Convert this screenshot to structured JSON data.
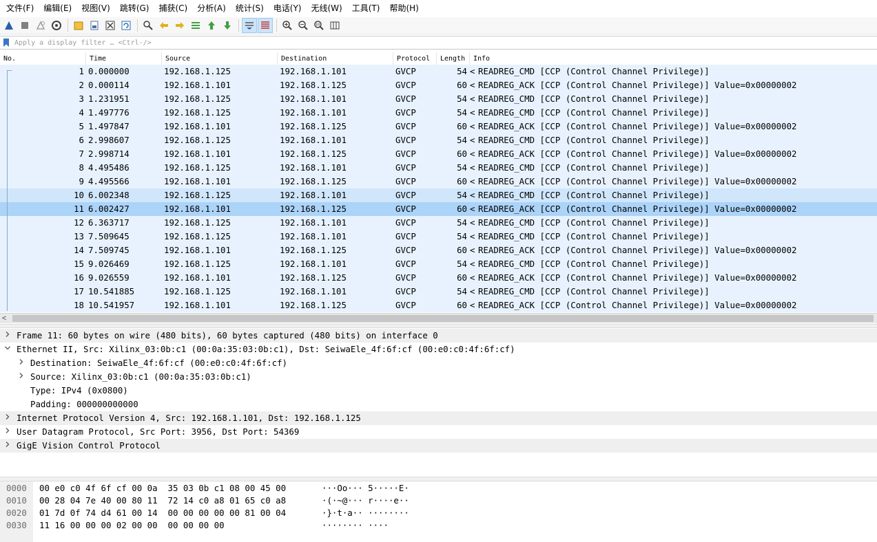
{
  "menu": [
    "文件(F)",
    "编辑(E)",
    "视图(V)",
    "跳转(G)",
    "捕获(C)",
    "分析(A)",
    "统计(S)",
    "电话(Y)",
    "无线(W)",
    "工具(T)",
    "帮助(H)"
  ],
  "filter": {
    "placeholder": "Apply a display filter … <Ctrl-/>"
  },
  "columns": {
    "no": "No.",
    "time": "Time",
    "source": "Source",
    "destination": "Destination",
    "protocol": "Protocol",
    "length": "Length",
    "info": "Info"
  },
  "packets": [
    {
      "no": "1",
      "time": "0.000000",
      "src": "192.168.1.125",
      "dst": "192.168.1.101",
      "proto": "GVCP",
      "len": "54",
      "info": "READREG_CMD [CCP (Control Channel Privilege)]"
    },
    {
      "no": "2",
      "time": "0.000114",
      "src": "192.168.1.101",
      "dst": "192.168.1.125",
      "proto": "GVCP",
      "len": "60",
      "info": "READREG_ACK [CCP (Control Channel Privilege)] Value=0x00000002"
    },
    {
      "no": "3",
      "time": "1.231951",
      "src": "192.168.1.125",
      "dst": "192.168.1.101",
      "proto": "GVCP",
      "len": "54",
      "info": "READREG_CMD [CCP (Control Channel Privilege)]"
    },
    {
      "no": "4",
      "time": "1.497776",
      "src": "192.168.1.125",
      "dst": "192.168.1.101",
      "proto": "GVCP",
      "len": "54",
      "info": "READREG_CMD [CCP (Control Channel Privilege)]"
    },
    {
      "no": "5",
      "time": "1.497847",
      "src": "192.168.1.101",
      "dst": "192.168.1.125",
      "proto": "GVCP",
      "len": "60",
      "info": "READREG_ACK [CCP (Control Channel Privilege)] Value=0x00000002"
    },
    {
      "no": "6",
      "time": "2.998607",
      "src": "192.168.1.125",
      "dst": "192.168.1.101",
      "proto": "GVCP",
      "len": "54",
      "info": "READREG_CMD [CCP (Control Channel Privilege)]"
    },
    {
      "no": "7",
      "time": "2.998714",
      "src": "192.168.1.101",
      "dst": "192.168.1.125",
      "proto": "GVCP",
      "len": "60",
      "info": "READREG_ACK [CCP (Control Channel Privilege)] Value=0x00000002"
    },
    {
      "no": "8",
      "time": "4.495486",
      "src": "192.168.1.125",
      "dst": "192.168.1.101",
      "proto": "GVCP",
      "len": "54",
      "info": "READREG_CMD [CCP (Control Channel Privilege)]"
    },
    {
      "no": "9",
      "time": "4.495566",
      "src": "192.168.1.101",
      "dst": "192.168.1.125",
      "proto": "GVCP",
      "len": "60",
      "info": "READREG_ACK [CCP (Control Channel Privilege)] Value=0x00000002"
    },
    {
      "no": "10",
      "time": "6.002348",
      "src": "192.168.1.125",
      "dst": "192.168.1.101",
      "proto": "GVCP",
      "len": "54",
      "info": "READREG_CMD [CCP (Control Channel Privilege)]"
    },
    {
      "no": "11",
      "time": "6.002427",
      "src": "192.168.1.101",
      "dst": "192.168.1.125",
      "proto": "GVCP",
      "len": "60",
      "info": "READREG_ACK [CCP (Control Channel Privilege)] Value=0x00000002"
    },
    {
      "no": "12",
      "time": "6.363717",
      "src": "192.168.1.125",
      "dst": "192.168.1.101",
      "proto": "GVCP",
      "len": "54",
      "info": "READREG_CMD [CCP (Control Channel Privilege)]"
    },
    {
      "no": "13",
      "time": "7.509645",
      "src": "192.168.1.125",
      "dst": "192.168.1.101",
      "proto": "GVCP",
      "len": "54",
      "info": "READREG_CMD [CCP (Control Channel Privilege)]"
    },
    {
      "no": "14",
      "time": "7.509745",
      "src": "192.168.1.101",
      "dst": "192.168.1.125",
      "proto": "GVCP",
      "len": "60",
      "info": "READREG_ACK [CCP (Control Channel Privilege)] Value=0x00000002"
    },
    {
      "no": "15",
      "time": "9.026469",
      "src": "192.168.1.125",
      "dst": "192.168.1.101",
      "proto": "GVCP",
      "len": "54",
      "info": "READREG_CMD [CCP (Control Channel Privilege)]"
    },
    {
      "no": "16",
      "time": "9.026559",
      "src": "192.168.1.101",
      "dst": "192.168.1.125",
      "proto": "GVCP",
      "len": "60",
      "info": "READREG_ACK [CCP (Control Channel Privilege)] Value=0x00000002"
    },
    {
      "no": "17",
      "time": "10.541885",
      "src": "192.168.1.125",
      "dst": "192.168.1.101",
      "proto": "GVCP",
      "len": "54",
      "info": "READREG_CMD [CCP (Control Channel Privilege)]"
    },
    {
      "no": "18",
      "time": "10.541957",
      "src": "192.168.1.101",
      "dst": "192.168.1.125",
      "proto": "GVCP",
      "len": "60",
      "info": "READREG_ACK [CCP (Control Channel Privilege)] Value=0x00000002"
    }
  ],
  "selected_packet": "11",
  "related_packet": "10",
  "details": [
    {
      "text": "Frame 11: 60 bytes on wire (480 bits), 60 bytes captured (480 bits) on interface 0",
      "level": 0,
      "expander": "collapsed",
      "shaded": true
    },
    {
      "text": "Ethernet II, Src: Xilinx_03:0b:c1 (00:0a:35:03:0b:c1), Dst: SeiwaEle_4f:6f:cf (00:e0:c0:4f:6f:cf)",
      "level": 0,
      "expander": "expanded",
      "shaded": false
    },
    {
      "text": "Destination: SeiwaEle_4f:6f:cf (00:e0:c0:4f:6f:cf)",
      "level": 1,
      "expander": "collapsed",
      "shaded": false
    },
    {
      "text": "Source: Xilinx_03:0b:c1 (00:0a:35:03:0b:c1)",
      "level": 1,
      "expander": "collapsed",
      "shaded": false
    },
    {
      "text": "Type: IPv4 (0x0800)",
      "level": 1,
      "expander": "none",
      "shaded": false
    },
    {
      "text": "Padding: 000000000000",
      "level": 1,
      "expander": "none",
      "shaded": false
    },
    {
      "text": "Internet Protocol Version 4, Src: 192.168.1.101, Dst: 192.168.1.125",
      "level": 0,
      "expander": "collapsed",
      "shaded": true
    },
    {
      "text": "User Datagram Protocol, Src Port: 3956, Dst Port: 54369",
      "level": 0,
      "expander": "collapsed",
      "shaded": false
    },
    {
      "text": "GigE Vision Control Protocol",
      "level": 0,
      "expander": "collapsed",
      "shaded": true
    }
  ],
  "bytes": [
    {
      "offset": "0000",
      "hex": "00 e0 c0 4f 6f cf 00 0a  35 03 0b c1 08 00 45 00",
      "ascii": "···Oo··· 5·····E·"
    },
    {
      "offset": "0010",
      "hex": "00 28 04 7e 40 00 80 11  72 14 c0 a8 01 65 c0 a8",
      "ascii": "·(·~@··· r····e··"
    },
    {
      "offset": "0020",
      "hex": "01 7d 0f 74 d4 61 00 14  00 00 00 00 00 81 00 04",
      "ascii": "·}·t·a·· ········"
    },
    {
      "offset": "0030",
      "hex": "11 16 00 00 00 02 00 00  00 00 00 00",
      "ascii": "········ ····"
    }
  ],
  "toolbar": [
    {
      "name": "start-capture-icon",
      "color": "#2a5db0"
    },
    {
      "name": "stop-capture-icon",
      "color": "#808080"
    },
    {
      "name": "restart-capture-icon",
      "color": "#a0a0a0"
    },
    {
      "name": "capture-options-icon",
      "color": "#404040"
    },
    {
      "name": "open-file-icon",
      "color": "#f0c040"
    },
    {
      "name": "save-file-icon",
      "color": "#4a6fa5"
    },
    {
      "name": "close-file-icon",
      "color": "#404040"
    },
    {
      "name": "reload-file-icon",
      "color": "#2a6fb0"
    },
    {
      "name": "find-packet-icon",
      "color": "#404040"
    },
    {
      "name": "go-back-icon",
      "color": "#e0b020"
    },
    {
      "name": "go-forward-icon",
      "color": "#e0b020"
    },
    {
      "name": "go-to-packet-icon",
      "color": "#40a040"
    },
    {
      "name": "first-packet-icon",
      "color": "#40a040"
    },
    {
      "name": "last-packet-icon",
      "color": "#40a040"
    },
    {
      "name": "autoscroll-icon",
      "color": "#2a5db0"
    },
    {
      "name": "colorize-icon",
      "color": "#c03030"
    },
    {
      "name": "zoom-in-icon",
      "color": "#404040"
    },
    {
      "name": "zoom-out-icon",
      "color": "#404040"
    },
    {
      "name": "normal-size-icon",
      "color": "#404040"
    },
    {
      "name": "resize-columns-icon",
      "color": "#404040"
    }
  ]
}
